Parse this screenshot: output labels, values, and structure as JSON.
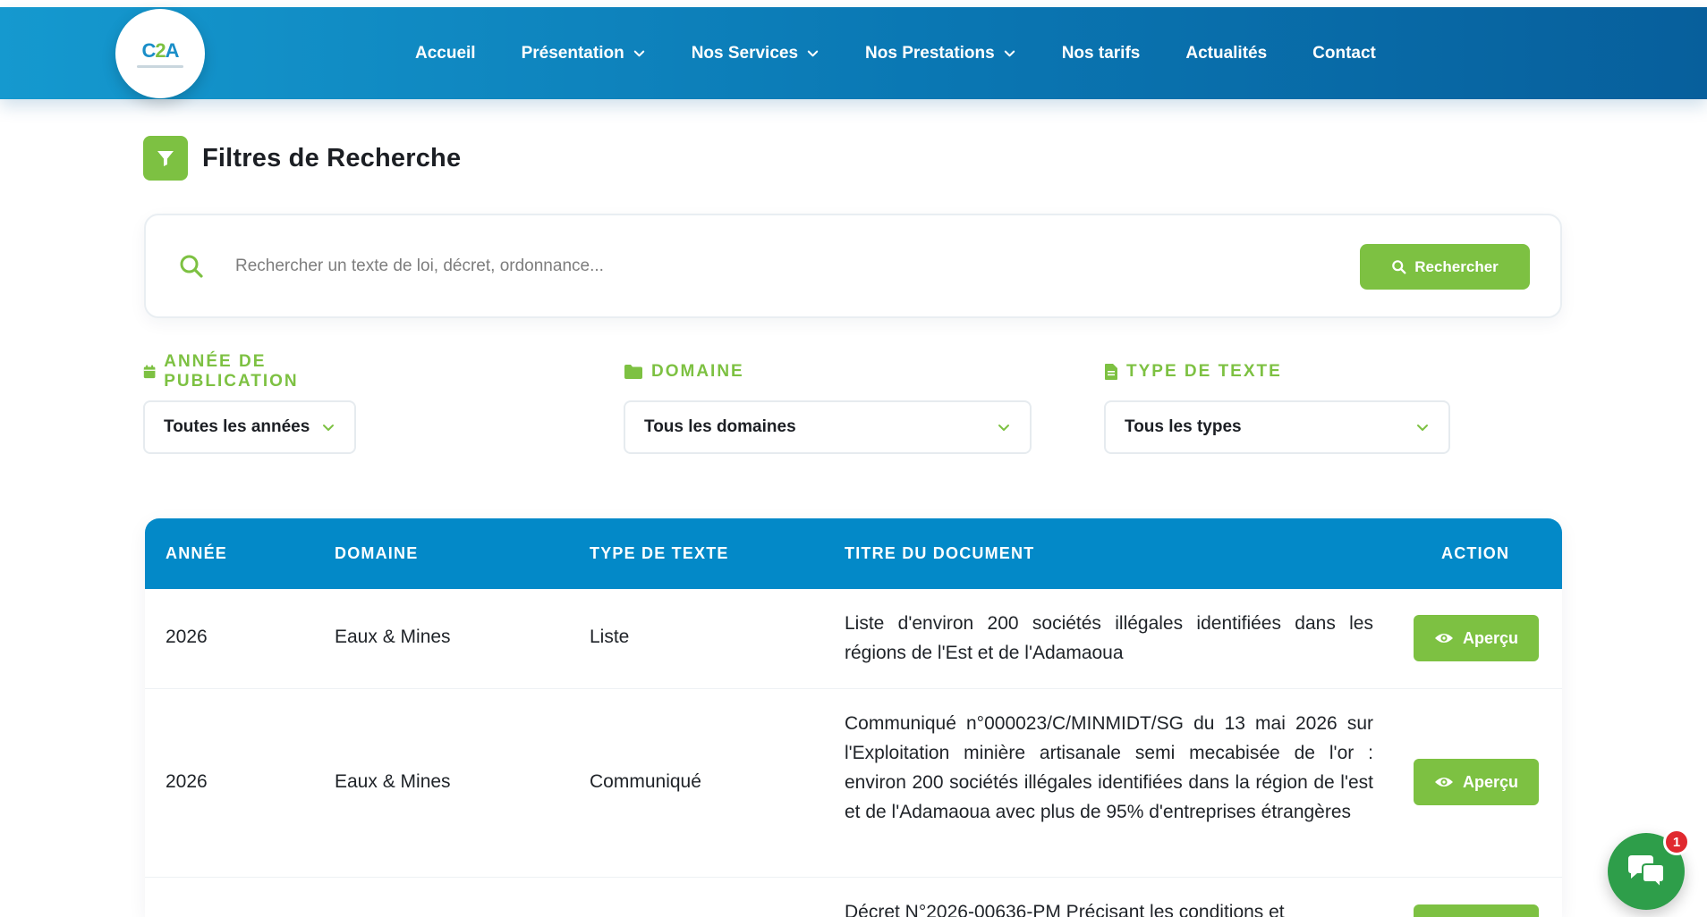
{
  "header": {
    "logo_alt": "C2A",
    "nav": [
      {
        "label": "Accueil",
        "has_dropdown": false
      },
      {
        "label": "Présentation",
        "has_dropdown": true
      },
      {
        "label": "Nos Services",
        "has_dropdown": true
      },
      {
        "label": "Nos Prestations",
        "has_dropdown": true
      },
      {
        "label": "Nos tarifs",
        "has_dropdown": false
      },
      {
        "label": "Actualités",
        "has_dropdown": false
      },
      {
        "label": "Contact",
        "has_dropdown": false
      }
    ]
  },
  "filters": {
    "title": "Filtres de Recherche",
    "search_placeholder": "Rechercher un texte de loi, décret, ordonnance...",
    "search_button": "Rechercher",
    "year_label": "ANNÉE DE PUBLICATION",
    "year_selected": "Toutes les années",
    "domain_label": "DOMAINE",
    "domain_selected": "Tous les domaines",
    "type_label": "TYPE DE TEXTE",
    "type_selected": "Tous les types"
  },
  "table": {
    "headers": {
      "year": "ANNÉE",
      "domain": "DOMAINE",
      "type": "TYPE DE TEXTE",
      "title": "TITRE DU DOCUMENT",
      "action": "ACTION"
    },
    "action_label": "Aperçu",
    "rows": [
      {
        "year": "2026",
        "domain": "Eaux & Mines",
        "type": "Liste",
        "title": "Liste d'environ 200 sociétés illégales identifiées dans les régions de l'Est et de l'Adamaoua"
      },
      {
        "year": "2026",
        "domain": "Eaux & Mines",
        "type": "Communiqué",
        "title": "Communiqué n°000023/C/MINMIDT/SG du 13 mai 2026 sur l'Exploitation minière artisanale semi mecabisée de l'or : environ 200 sociétés illégales identifiées dans la région de l'est et de l'Adamaoua avec plus de 95% d'entreprises étrangères"
      },
      {
        "year": "",
        "domain": "",
        "type": "",
        "title": "Décret N°2026-00636-PM Précisant les conditions et"
      }
    ]
  },
  "chat": {
    "badge_count": "1"
  },
  "colors": {
    "brand_blue": "#0389c8",
    "brand_green": "#7dc142",
    "chat_green": "#2e9e4a",
    "badge_red": "#e0292f"
  },
  "icons": {
    "filter": "filter-icon",
    "search": "search-icon",
    "calendar": "calendar-icon",
    "folder": "folder-icon",
    "file": "file-icon",
    "eye": "eye-icon",
    "chevron": "chevron-down-icon",
    "chat": "chat-bubbles-icon"
  }
}
